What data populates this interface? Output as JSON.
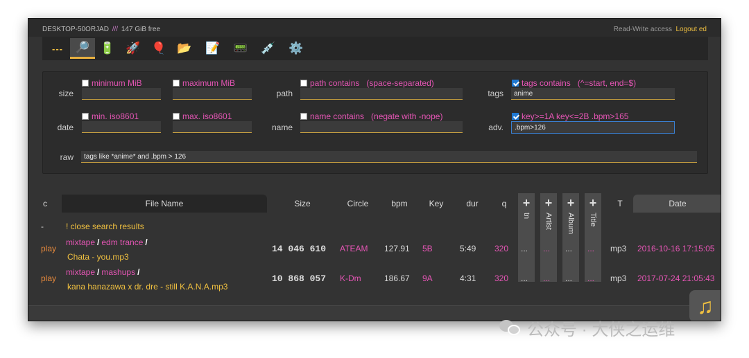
{
  "header": {
    "hostname": "DESKTOP-50ORJAD",
    "separator": "///",
    "free_space": "147 GiB free",
    "access": "Read-Write access",
    "logout": "Logout ed"
  },
  "toolbar": {
    "items": [
      {
        "name": "dash",
        "glyph": "---"
      },
      {
        "name": "search",
        "glyph": "🔎"
      },
      {
        "name": "battery",
        "glyph": "🔋"
      },
      {
        "name": "rocket",
        "glyph": "🚀"
      },
      {
        "name": "balloon",
        "glyph": "🎈"
      },
      {
        "name": "folder",
        "glyph": "📂"
      },
      {
        "name": "memo",
        "glyph": "📝"
      },
      {
        "name": "terminal",
        "glyph": "📟"
      },
      {
        "name": "syringe",
        "glyph": "💉"
      },
      {
        "name": "gear",
        "glyph": "⚙️"
      }
    ],
    "active": "search"
  },
  "search": {
    "size_label": "size",
    "min_mib": "minimum MiB",
    "max_mib": "maximum MiB",
    "path_label": "path",
    "path_contains": "path contains",
    "path_hint": "(space-separated)",
    "tags_label": "tags",
    "tags_contains": "tags contains",
    "tags_hint": "(^=start, end=$)",
    "tags_value": "anime",
    "date_label": "date",
    "min_iso": "min. iso8601",
    "max_iso": "max. iso8601",
    "name_label": "name",
    "name_contains": "name contains",
    "name_hint": "(negate with -nope)",
    "adv_label": "adv.",
    "adv_check": "key>=1A  key<=2B  .bpm>165",
    "adv_value": ".bpm>126",
    "raw_label": "raw",
    "raw_value": "tags like *anime* and .bpm > 126"
  },
  "table": {
    "headers": {
      "c": "c",
      "file_name": "File Name",
      "size": "Size",
      "circle": "Circle",
      "bpm": "bpm",
      "key": "Key",
      "dur": "dur",
      "q": "q",
      "t": "T",
      "date": "Date"
    },
    "tag_columns": [
      "tn",
      "Artist",
      "Album",
      "Title"
    ],
    "plus": "+",
    "close_row": {
      "c": "-",
      "text": "! close search results"
    },
    "rows": [
      {
        "action": "play",
        "path": [
          "mixtape",
          "edm trance"
        ],
        "slash": "/",
        "file": "Chata - you.mp3",
        "size": "14 046 610",
        "circle": "ATEAM",
        "bpm": "127.91",
        "key": "5B",
        "dur": "5:49",
        "q": "320",
        "tn": "...",
        "artist": "...",
        "album": "...",
        "title": "...",
        "type": "mp3",
        "date": "2016-10-16 17:15:05"
      },
      {
        "action": "play",
        "path": [
          "mixtape",
          "mashups"
        ],
        "slash": "/",
        "file": "kana hanazawa x dr. dre - still K.A.N.A.mp3",
        "size": "10 868 057",
        "circle": "K-Dm",
        "bpm": "186.67",
        "key": "9A",
        "dur": "4:31",
        "q": "320",
        "tn": "...",
        "artist": "...",
        "album": "...",
        "title": "...",
        "type": "mp3",
        "date": "2017-07-24 21:05:43"
      }
    ]
  },
  "music_button": "♫",
  "watermark": "公众号 · 大侠之运维",
  "colors": {
    "accent_yellow": "#f0c040",
    "accent_pink": "#e455b4",
    "accent_orange": "#e88a3c",
    "focus_blue": "#3a7fd0"
  }
}
